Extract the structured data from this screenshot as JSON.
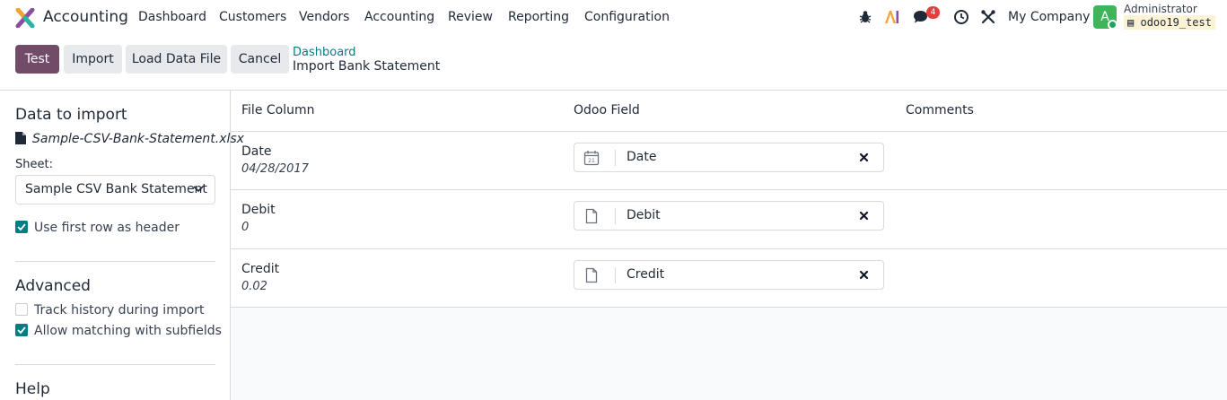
{
  "navbar": {
    "app_name": "Accounting",
    "menus": [
      "Dashboard",
      "Customers",
      "Vendors",
      "Accounting",
      "Review",
      "Reporting",
      "Configuration"
    ],
    "messages_count": "4",
    "company": "My Company",
    "user_initial": "A",
    "user_name": "Administrator",
    "database": "odoo19_test",
    "icons": [
      "bug-icon",
      "ai-icon",
      "messages-icon",
      "clock-icon",
      "tools-icon"
    ]
  },
  "control_panel": {
    "buttons": [
      "Test",
      "Import",
      "Load Data File",
      "Cancel"
    ],
    "breadcrumb_link": "Dashboard",
    "breadcrumb_current": "Import Bank Statement"
  },
  "sidebar": {
    "data_title": "Data to import",
    "file_name": "Sample-CSV-Bank-Statement.xlsx",
    "sheet_label": "Sheet:",
    "sheet_value": "Sample CSV Bank Statement",
    "use_header_label": "Use first row as header",
    "use_header_checked": true,
    "advanced_title": "Advanced",
    "track_history_label": "Track history during import",
    "track_history_checked": false,
    "subfields_label": "Allow matching with subfields",
    "subfields_checked": true,
    "help_title": "Help"
  },
  "table": {
    "headers": [
      "File Column",
      "Odoo Field",
      "Comments"
    ],
    "rows": [
      {
        "column": "Date",
        "sample": "04/28/2017",
        "field": "Date",
        "field_icon": "calendar-icon"
      },
      {
        "column": "Debit",
        "sample": "0",
        "field": "Debit",
        "field_icon": "document-icon"
      },
      {
        "column": "Credit",
        "sample": "0.02",
        "field": "Credit",
        "field_icon": "document-icon"
      }
    ]
  },
  "colors": {
    "primary": "#714b67",
    "accent": "#017e84",
    "avatar": "#3fb55b",
    "badge": "#e53e3e"
  }
}
